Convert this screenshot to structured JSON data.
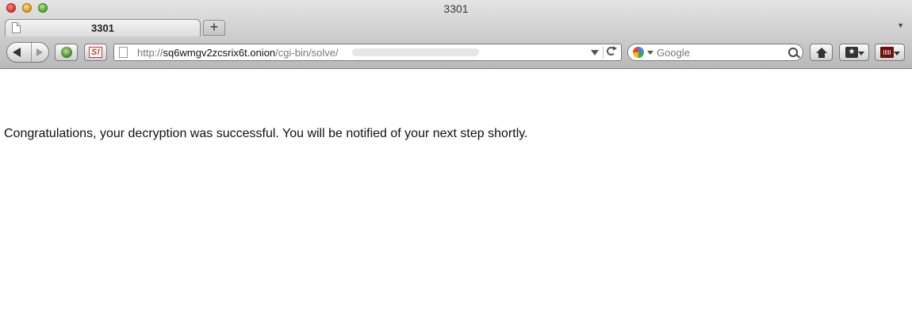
{
  "window": {
    "title": "3301"
  },
  "tabs": [
    {
      "label": "3301"
    }
  ],
  "toolbar": {
    "url": {
      "scheme": "http://",
      "host": "sq6wmgv2zcsrix6t.onion",
      "path": "/cgi-bin/solve/"
    },
    "search": {
      "placeholder": "Google",
      "engine_icon": "google-icon"
    }
  },
  "page": {
    "message": "Congratulations, your decryption was successful. You will be notified of your next step shortly."
  }
}
